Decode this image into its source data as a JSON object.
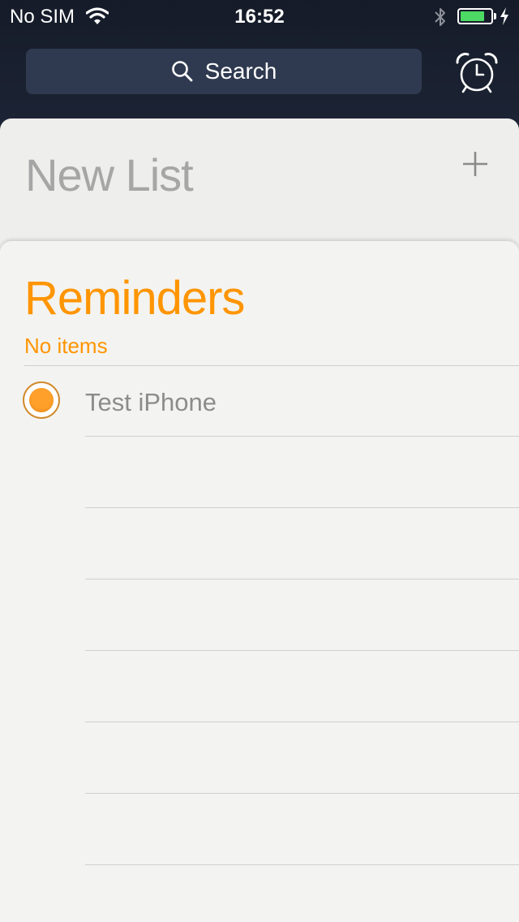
{
  "status_bar": {
    "carrier": "No SIM",
    "time": "16:52",
    "battery_level": 0.8,
    "wifi_icon": "wifi-icon",
    "bluetooth_icon": "bluetooth-icon",
    "charging_icon": "charging-bolt-icon"
  },
  "search": {
    "label": "Search",
    "icon": "search-icon"
  },
  "alarm": {
    "icon": "alarm-clock-icon"
  },
  "new_list": {
    "title": "New List",
    "add_icon": "plus-icon"
  },
  "reminders": {
    "title": "Reminders",
    "count_text": "No items",
    "items": [
      {
        "text": "Test iPhone",
        "completed": false
      }
    ],
    "empty_rows": 6
  },
  "colors": {
    "accent": "#ff9500",
    "header_background": "#1c2231",
    "card_background": "#f3f3f1",
    "battery_fill": "#4cd964"
  }
}
